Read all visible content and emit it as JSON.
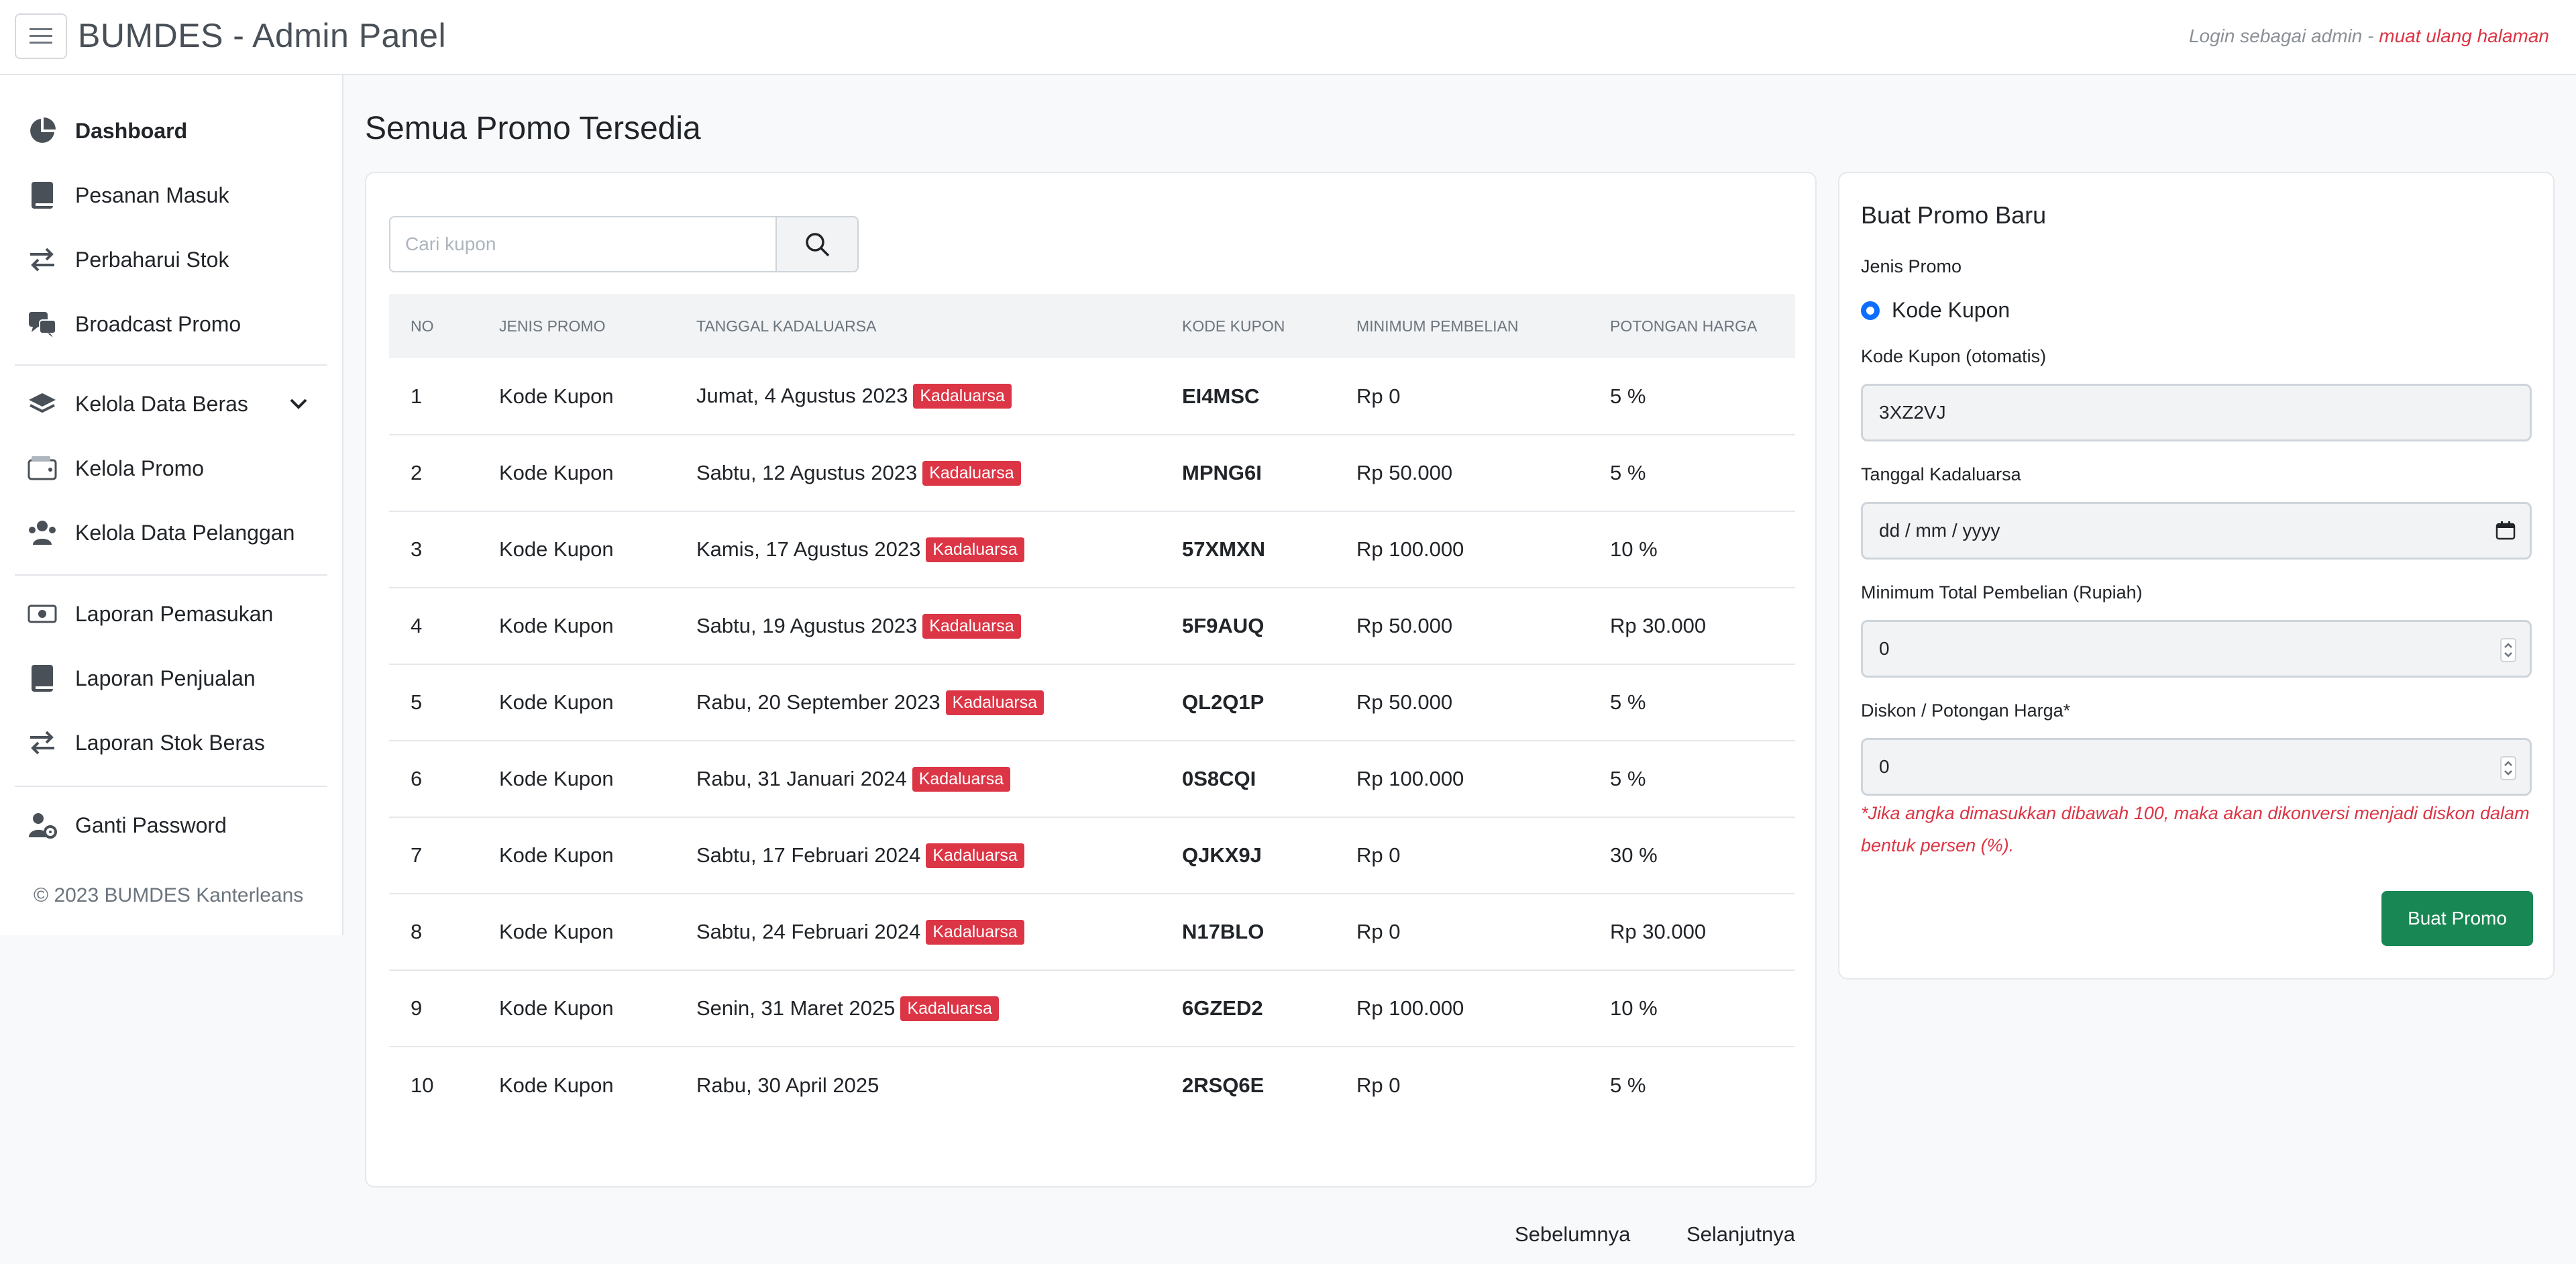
{
  "header": {
    "brand": "BUMDES - Admin Panel",
    "login_text": "Login sebagai admin",
    "separator": " - ",
    "reload_link": "muat ulang halaman"
  },
  "sidebar": {
    "items": [
      {
        "label": "Dashboard",
        "icon": "pie-chart-icon"
      },
      {
        "label": "Pesanan Masuk",
        "icon": "book-icon"
      },
      {
        "label": "Perbaharui Stok",
        "icon": "arrows-exchange-icon"
      },
      {
        "label": "Broadcast Promo",
        "icon": "chat-bubbles-icon"
      },
      {
        "label": "Kelola Data Beras",
        "icon": "layers-icon"
      },
      {
        "label": "Kelola Promo",
        "icon": "wallet-icon"
      },
      {
        "label": "Kelola Data Pelanggan",
        "icon": "users-icon"
      },
      {
        "label": "Laporan Pemasukan",
        "icon": "cash-icon"
      },
      {
        "label": "Laporan Penjualan",
        "icon": "book-icon"
      },
      {
        "label": "Laporan Stok Beras",
        "icon": "arrows-exchange-icon"
      },
      {
        "label": "Ganti Password",
        "icon": "user-gear-icon"
      }
    ],
    "footer": "© 2023 BUMDES Kanterleans"
  },
  "main": {
    "title": "Semua Promo Tersedia",
    "search_placeholder": "Cari kupon",
    "columns": [
      "NO",
      "JENIS PROMO",
      "TANGGAL KADALUARSA",
      "KODE KUPON",
      "MINIMUM PEMBELIAN",
      "POTONGAN HARGA"
    ],
    "expired_label": "Kadaluarsa",
    "rows": [
      {
        "no": "1",
        "type": "Kode Kupon",
        "date": "Jumat, 4 Agustus 2023",
        "expired": true,
        "code": "EI4MSC",
        "min": "Rp 0",
        "discount": "5 %"
      },
      {
        "no": "2",
        "type": "Kode Kupon",
        "date": "Sabtu, 12 Agustus 2023",
        "expired": true,
        "code": "MPNG6I",
        "min": "Rp 50.000",
        "discount": "5 %"
      },
      {
        "no": "3",
        "type": "Kode Kupon",
        "date": "Kamis, 17 Agustus 2023",
        "expired": true,
        "code": "57XMXN",
        "min": "Rp 100.000",
        "discount": "10 %"
      },
      {
        "no": "4",
        "type": "Kode Kupon",
        "date": "Sabtu, 19 Agustus 2023",
        "expired": true,
        "code": "5F9AUQ",
        "min": "Rp 50.000",
        "discount": "Rp 30.000"
      },
      {
        "no": "5",
        "type": "Kode Kupon",
        "date": "Rabu, 20 September 2023",
        "expired": true,
        "code": "QL2Q1P",
        "min": "Rp 50.000",
        "discount": "5 %"
      },
      {
        "no": "6",
        "type": "Kode Kupon",
        "date": "Rabu, 31 Januari 2024",
        "expired": true,
        "code": "0S8CQI",
        "min": "Rp 100.000",
        "discount": "5 %"
      },
      {
        "no": "7",
        "type": "Kode Kupon",
        "date": "Sabtu, 17 Februari 2024",
        "expired": true,
        "code": "QJKX9J",
        "min": "Rp 0",
        "discount": "30 %"
      },
      {
        "no": "8",
        "type": "Kode Kupon",
        "date": "Sabtu, 24 Februari 2024",
        "expired": true,
        "code": "N17BLO",
        "min": "Rp 0",
        "discount": "Rp 30.000"
      },
      {
        "no": "9",
        "type": "Kode Kupon",
        "date": "Senin, 31 Maret 2025",
        "expired": true,
        "code": "6GZED2",
        "min": "Rp 100.000",
        "discount": "10 %"
      },
      {
        "no": "10",
        "type": "Kode Kupon",
        "date": "Rabu, 30 April 2025",
        "expired": false,
        "code": "2RSQ6E",
        "min": "Rp 0",
        "discount": "5 %"
      }
    ],
    "prev_label": "Sebelumnya",
    "next_label": "Selanjutnya"
  },
  "form": {
    "title": "Buat Promo Baru",
    "type_label": "Jenis Promo",
    "type_option": "Kode Kupon",
    "code_label": "Kode Kupon (otomatis)",
    "code_value": "3XZ2VJ",
    "date_label": "Tanggal Kadaluarsa",
    "date_placeholder": "dd / mm / yyyy",
    "min_label": "Minimum Total Pembelian (Rupiah)",
    "min_value": "0",
    "discount_label": "Diskon / Potongan Harga*",
    "discount_value": "0",
    "note": "*Jika angka dimasukkan dibawah 100, maka akan dikonversi menjadi diskon dalam bentuk persen (%).",
    "submit_label": "Buat Promo"
  },
  "colors": {
    "danger": "#dc3545",
    "success": "#198754",
    "primary": "#0d6efd"
  }
}
